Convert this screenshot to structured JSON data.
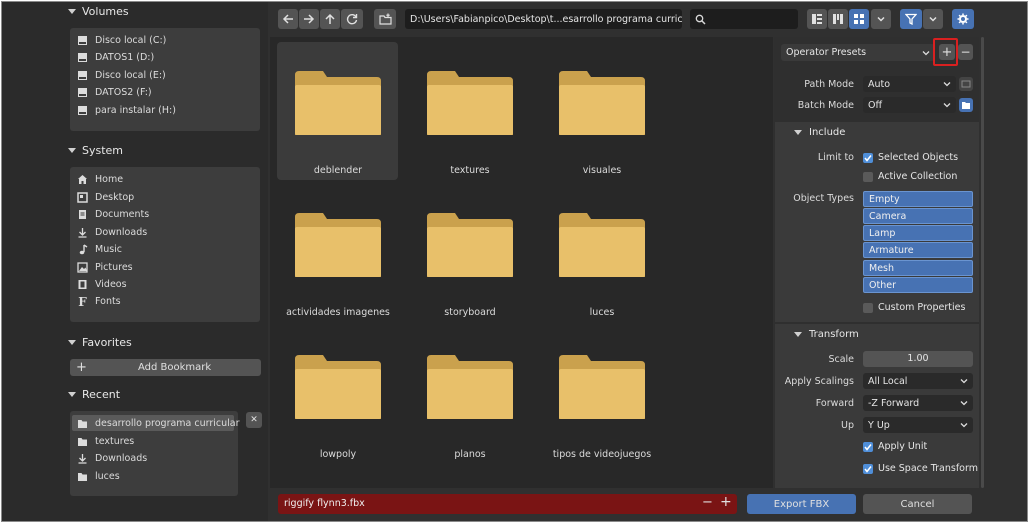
{
  "volumes": {
    "title": "Volumes",
    "items": [
      {
        "label": "Disco local (C:)"
      },
      {
        "label": "DATOS1 (D:)"
      },
      {
        "label": "Disco local (E:)"
      },
      {
        "label": "DATOS2 (F:)"
      },
      {
        "label": "para instalar (H:)"
      }
    ]
  },
  "system": {
    "title": "System",
    "items": [
      {
        "label": "Home"
      },
      {
        "label": "Desktop"
      },
      {
        "label": "Documents"
      },
      {
        "label": "Downloads"
      },
      {
        "label": "Music"
      },
      {
        "label": "Pictures"
      },
      {
        "label": "Videos"
      },
      {
        "label": "Fonts"
      }
    ]
  },
  "favorites": {
    "title": "Favorites",
    "add_bookmark": "Add Bookmark",
    "plus": "+"
  },
  "recent": {
    "title": "Recent",
    "items": [
      {
        "label": "desarrollo programa curricular"
      },
      {
        "label": "textures"
      },
      {
        "label": "Downloads"
      },
      {
        "label": "luces"
      }
    ],
    "close": "✕"
  },
  "toolbar": {
    "path": "D:\\Users\\Fabianpico\\Desktop\\t...esarrollo programa curricular\\",
    "search_placeholder": "",
    "search_value": ""
  },
  "files": [
    {
      "name": "deblender"
    },
    {
      "name": "textures"
    },
    {
      "name": "visuales"
    },
    {
      "name": "actividades imagenes"
    },
    {
      "name": "storyboard"
    },
    {
      "name": "luces"
    },
    {
      "name": "lowpoly"
    },
    {
      "name": "planos"
    },
    {
      "name": "tipos de videojuegos"
    }
  ],
  "bottom": {
    "filename": "riggify flynn3.fbx",
    "minus": "−",
    "plus": "+",
    "export_label": "Export FBX",
    "cancel_label": "Cancel"
  },
  "panel": {
    "operator_presets": "Operator Presets",
    "preset_plus": "+",
    "preset_minus": "−",
    "path_mode_label": "Path Mode",
    "path_mode_value": "Auto",
    "batch_mode_label": "Batch Mode",
    "batch_mode_value": "Off",
    "include": {
      "title": "Include",
      "limit_to_label": "Limit to",
      "selected_objects": "Selected Objects",
      "active_collection": "Active Collection",
      "object_types_label": "Object Types",
      "object_types": [
        "Empty",
        "Camera",
        "Lamp",
        "Armature",
        "Mesh",
        "Other"
      ],
      "custom_properties": "Custom Properties"
    },
    "transform": {
      "title": "Transform",
      "scale_label": "Scale",
      "scale_value": "1.00",
      "apply_scalings_label": "Apply Scalings",
      "apply_scalings_value": "All Local",
      "forward_label": "Forward",
      "forward_value": "-Z Forward",
      "up_label": "Up",
      "up_value": "Y Up",
      "apply_unit": "Apply Unit",
      "use_space_transform": "Use Space Transform"
    }
  },
  "colors": {
    "accent": "#4772b3",
    "folder": "#e8c06a",
    "cancel_red": "#7a1414",
    "highlight_red": "#d92020"
  }
}
